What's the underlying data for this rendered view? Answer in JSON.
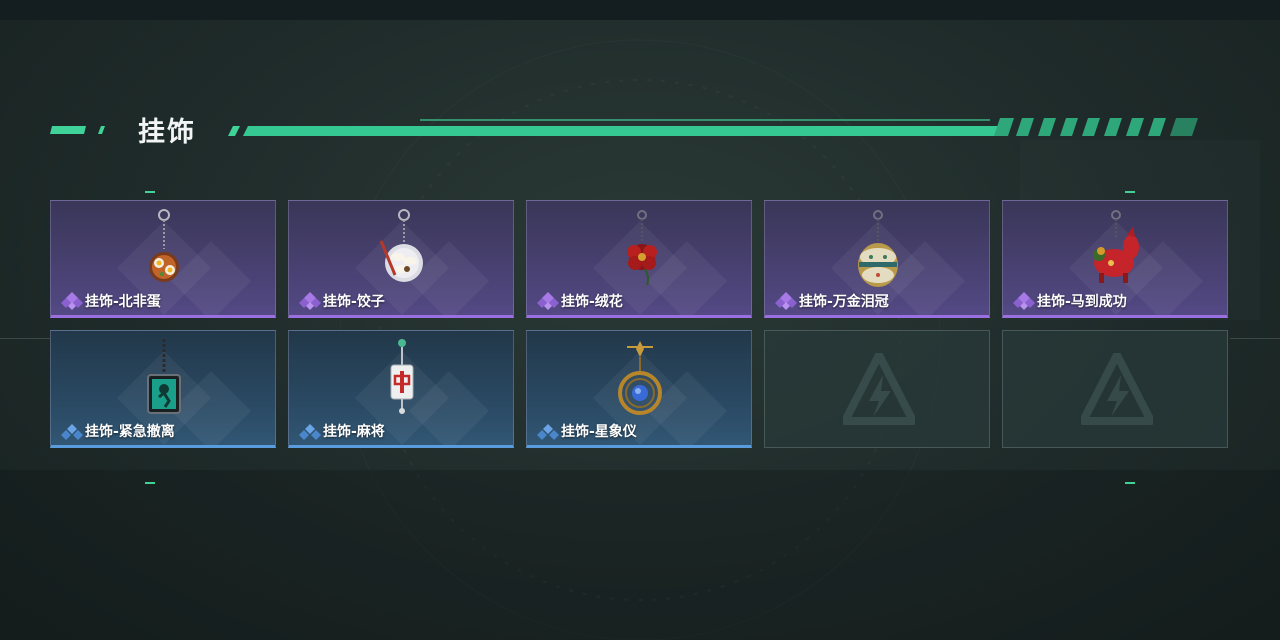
{
  "header": {
    "title": "挂饰"
  },
  "colors": {
    "accent": "#3fd39a",
    "epic": "#9a6fe0",
    "rare": "#5a9ddf"
  },
  "items": [
    {
      "label": "挂饰-北非蛋",
      "rarity": "epic",
      "icon": "shakshuka-charm-icon"
    },
    {
      "label": "挂饰-饺子",
      "rarity": "epic",
      "icon": "dumpling-plate-charm-icon"
    },
    {
      "label": "挂饰-绒花",
      "rarity": "epic",
      "icon": "velvet-flower-charm-icon"
    },
    {
      "label": "挂饰-万金泪冠",
      "rarity": "epic",
      "icon": "crown-egg-charm-icon"
    },
    {
      "label": "挂饰-马到成功",
      "rarity": "epic",
      "icon": "red-horse-charm-icon"
    },
    {
      "label": "挂饰-紧急撤离",
      "rarity": "rare",
      "icon": "emergency-exit-charm-icon"
    },
    {
      "label": "挂饰-麻将",
      "rarity": "rare",
      "icon": "mahjong-tile-charm-icon"
    },
    {
      "label": "挂饰-星象仪",
      "rarity": "rare",
      "icon": "astrolabe-charm-icon"
    },
    {
      "label": "",
      "rarity": "empty",
      "icon": "empty-slot-logo-icon"
    },
    {
      "label": "",
      "rarity": "empty",
      "icon": "empty-slot-logo-icon"
    }
  ]
}
